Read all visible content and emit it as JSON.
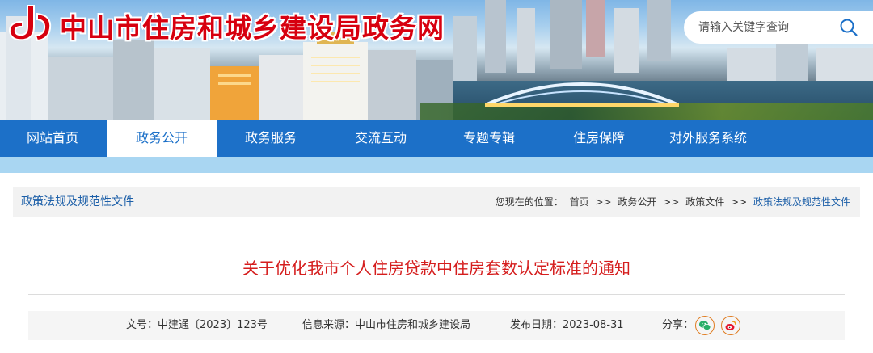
{
  "header": {
    "site_title": "中山市住房和城乡建设局政务网",
    "search": {
      "placeholder": "请输入关键字查询"
    },
    "brand_red": "#d7000f"
  },
  "nav": {
    "items": [
      {
        "label": "网站首页",
        "active": false
      },
      {
        "label": "政务公开",
        "active": true
      },
      {
        "label": "政务服务",
        "active": false
      },
      {
        "label": "交流互动",
        "active": false
      },
      {
        "label": "专题专辑",
        "active": false
      },
      {
        "label": "住房保障",
        "active": false
      },
      {
        "label": "对外服务系统",
        "active": false
      }
    ],
    "bg_color": "#1c70c8"
  },
  "breadcrumb": {
    "section_title": "政策法规及规范性文件",
    "location_label": "您现在的位置：",
    "path": [
      "首页",
      "政务公开",
      "政策文件",
      "政策法规及规范性文件"
    ],
    "separator": ">>"
  },
  "article": {
    "title": "关于优化我市个人住房贷款中住房套数认定标准的通知",
    "doc_no_label": "文号：",
    "doc_no": "中建通〔2023〕123号",
    "source_label": "信息来源：",
    "source": "中山市住房和城乡建设局",
    "date_label": "发布日期：",
    "date": "2023-08-31",
    "share_label": "分享：",
    "share_icons": [
      "wechat-icon",
      "weibo-icon"
    ],
    "title_color": "#d51d1d"
  }
}
